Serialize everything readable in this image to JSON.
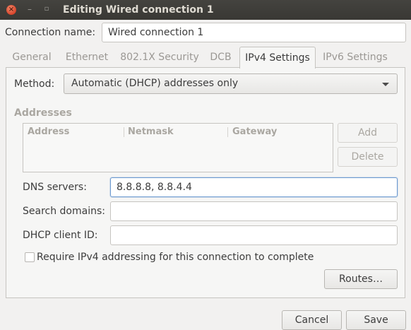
{
  "window": {
    "title": "Editing Wired connection 1",
    "close_glyph": "×",
    "minimize_glyph": "–",
    "maximize_glyph": "▫"
  },
  "connection": {
    "name_label": "Connection name:",
    "name_value": "Wired connection 1"
  },
  "tabs": [
    {
      "label": "General"
    },
    {
      "label": "Ethernet"
    },
    {
      "label": "802.1X Security"
    },
    {
      "label": "DCB"
    },
    {
      "label": "IPv4 Settings",
      "active": true
    },
    {
      "label": "IPv6 Settings"
    }
  ],
  "ipv4": {
    "method_label": "Method:",
    "method_value": "Automatic (DHCP) addresses only",
    "addresses_label": "Addresses",
    "columns": [
      "Address",
      "Netmask",
      "Gateway"
    ],
    "add_label": "Add",
    "delete_label": "Delete",
    "dns_label": "DNS servers:",
    "dns_value": "8.8.8.8, 8.8.4.4",
    "search_label": "Search domains:",
    "search_value": "",
    "dhcp_id_label": "DHCP client ID:",
    "dhcp_id_value": "",
    "require_label": "Require IPv4 addressing for this connection to complete",
    "require_checked": false,
    "routes_label": "Routes…"
  },
  "footer": {
    "cancel_label": "Cancel",
    "save_label": "Save"
  }
}
